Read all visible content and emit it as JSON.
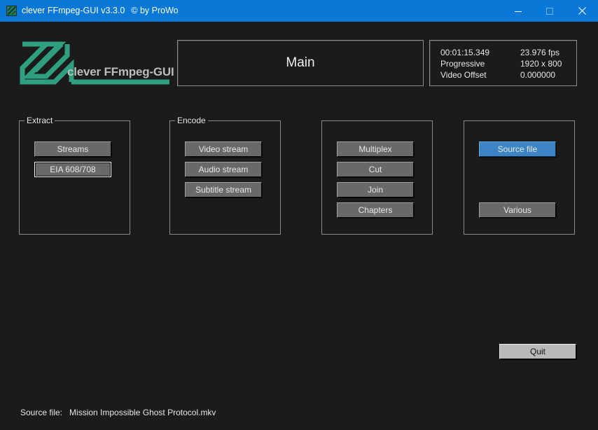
{
  "window": {
    "title": "clever FFmpeg-GUI v3.3.0",
    "copyright": "© by ProWo",
    "controls": {
      "minimize": "minimize-icon",
      "maximize": "maximize-icon",
      "close": "close-icon"
    }
  },
  "logo": {
    "text": "clever FFmpeg-GUI",
    "color": "#2f9f7e"
  },
  "header": {
    "title": "Main"
  },
  "info": {
    "time": "00:01:15.349",
    "fps": "23.976 fps",
    "scan": "Progressive",
    "resolution": "1920 x 800",
    "offset_label": "Video Offset",
    "offset_value": "0.000000"
  },
  "groups": {
    "extract": {
      "label": "Extract",
      "buttons": [
        "Streams",
        "EIA 608/708"
      ]
    },
    "encode": {
      "label": "Encode",
      "buttons": [
        "Video stream",
        "Audio stream",
        "Subtitle stream"
      ]
    },
    "tools": {
      "buttons": [
        "Multiplex",
        "Cut",
        "Join",
        "Chapters"
      ]
    },
    "misc": {
      "buttons": [
        "Source file",
        "Various"
      ]
    }
  },
  "quit_label": "Quit",
  "status": {
    "label": "Source file:",
    "value": "Mission Impossible Ghost Protocol.mkv"
  },
  "colors": {
    "titlebar": "#0a78d7",
    "accent_button": "#3d84c4",
    "background": "#1b1b1b"
  }
}
